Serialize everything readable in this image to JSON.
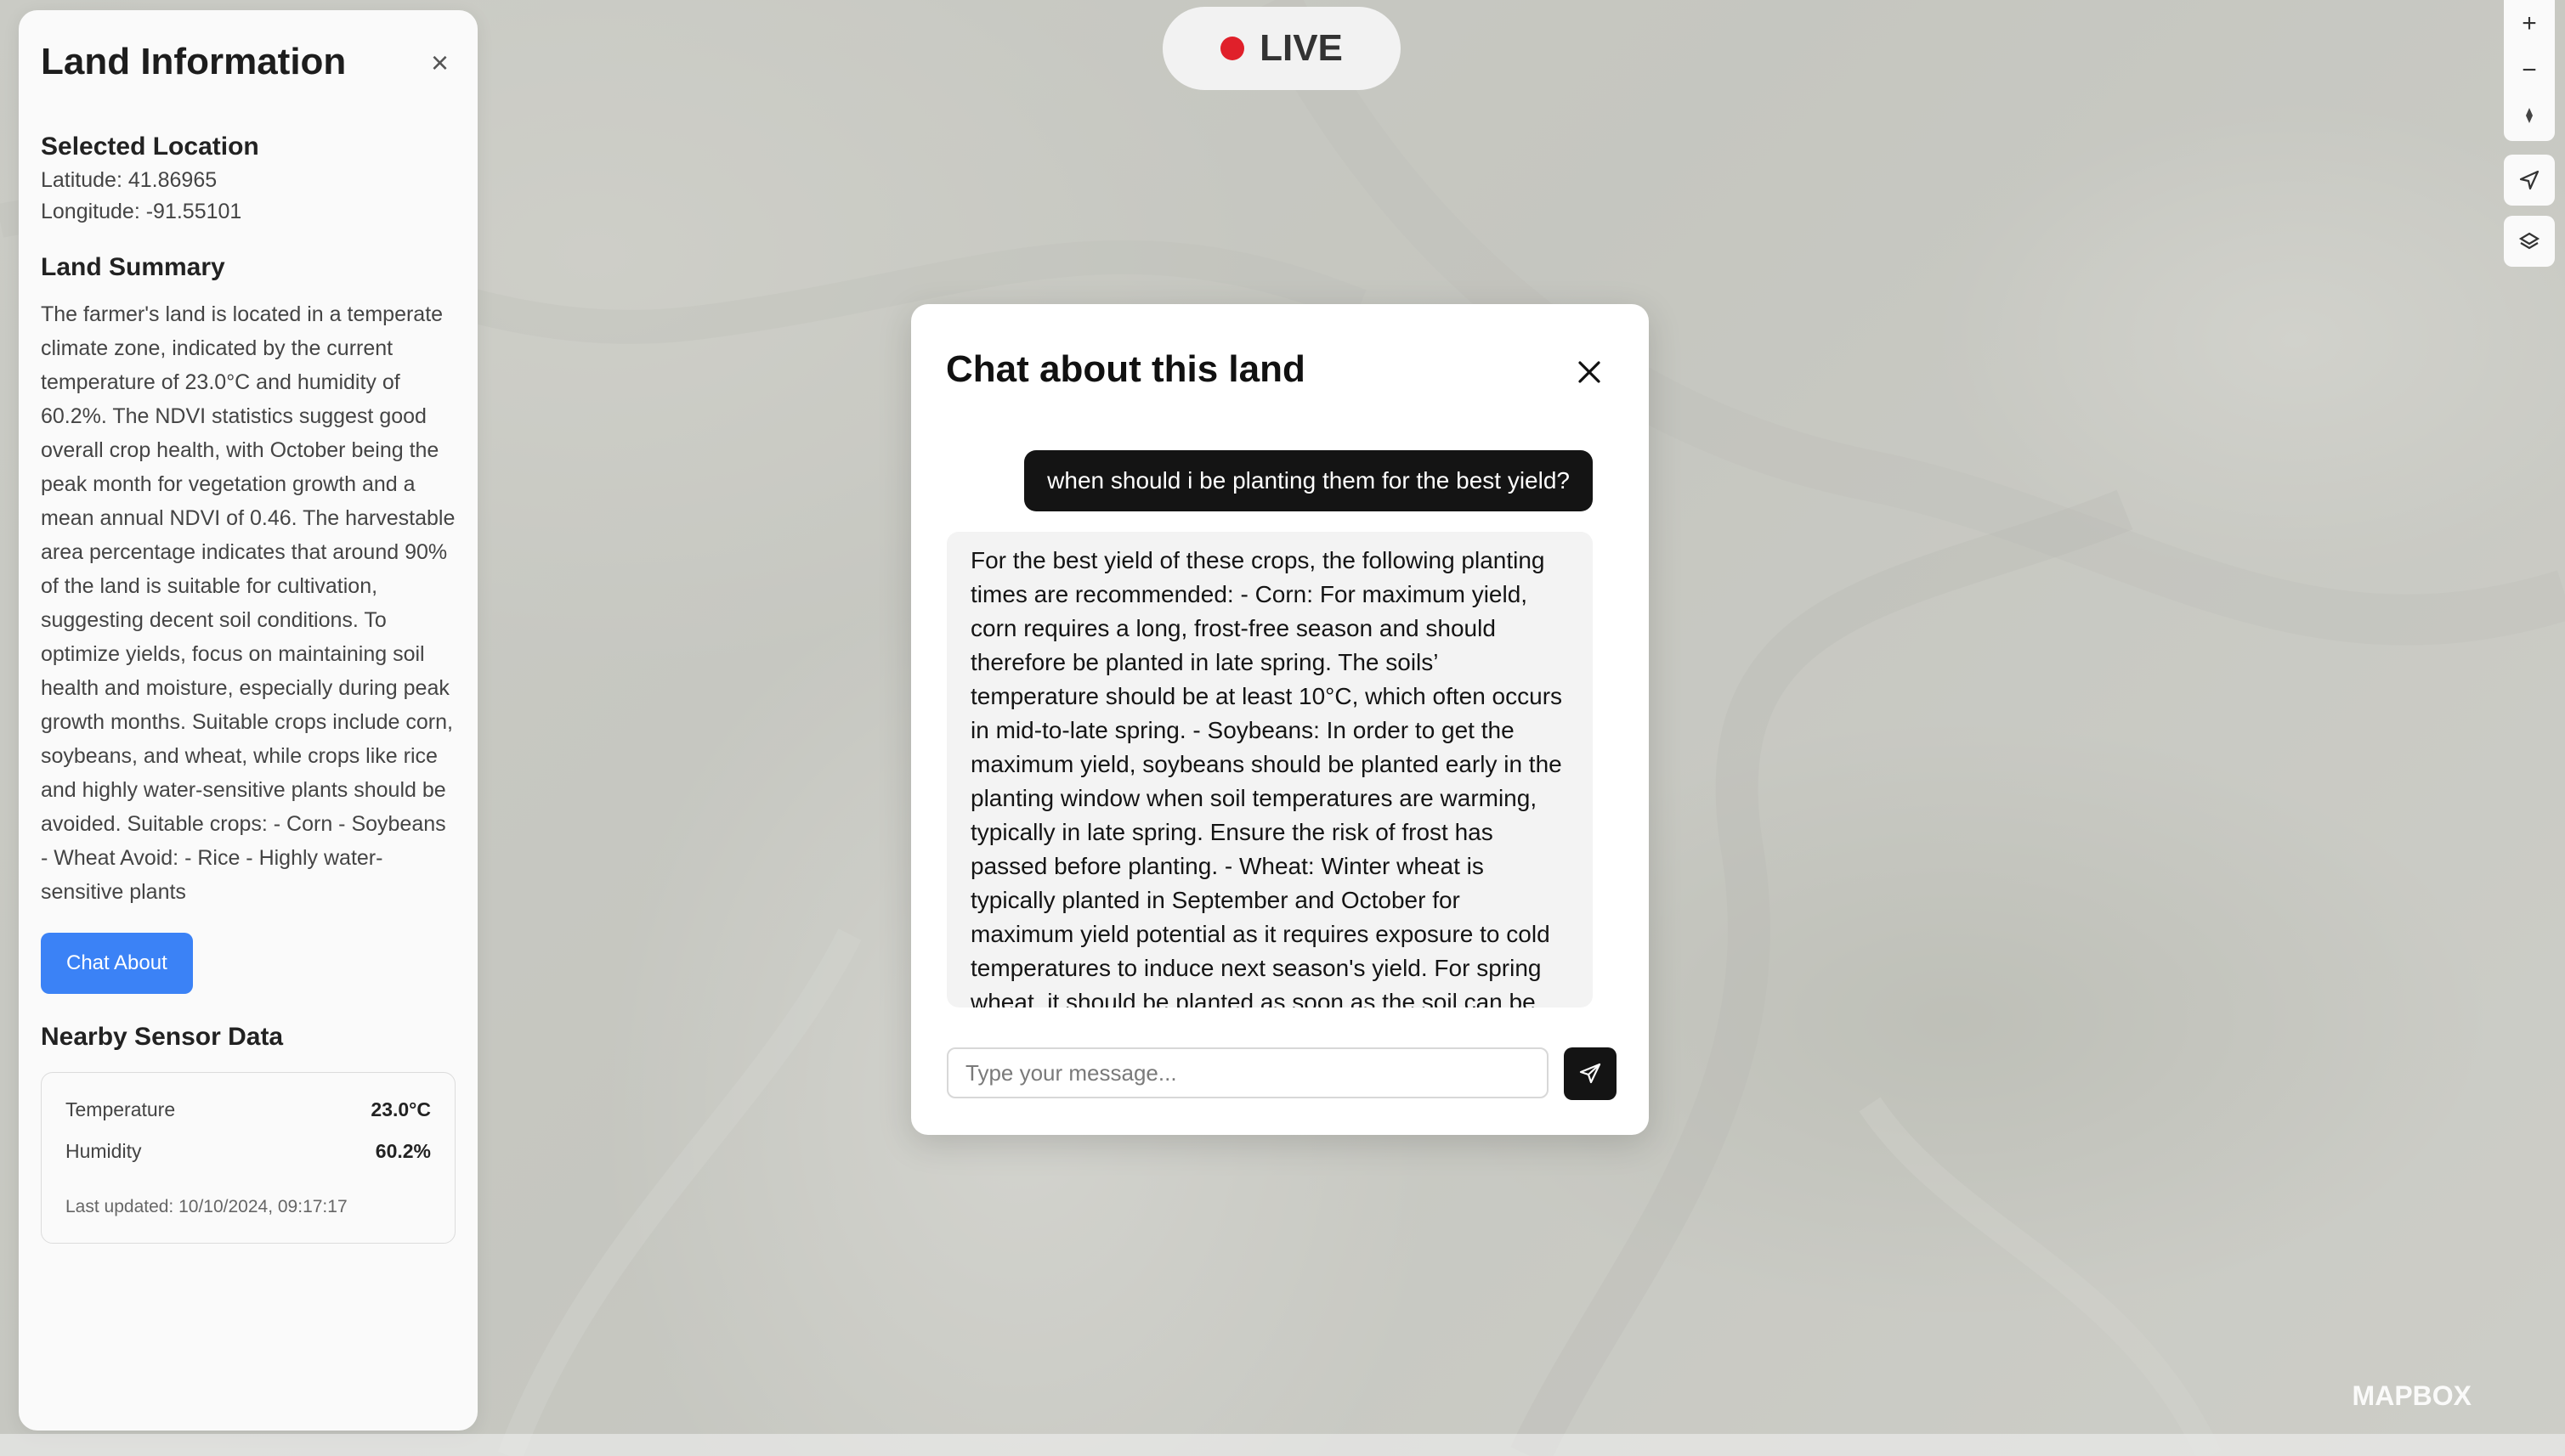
{
  "side_panel": {
    "title": "Land Information",
    "close_label": "×",
    "selected_location_heading": "Selected Location",
    "latitude": "Latitude: 41.86965",
    "longitude": "Longitude: -91.55101",
    "land_summary_heading": "Land Summary",
    "summary_text": "The farmer's land is located in a temperate climate zone, indicated by the current temperature of 23.0°C and humidity of 60.2%. The NDVI statistics suggest good overall crop health, with October being the peak month for vegetation growth and a mean annual NDVI of 0.46. The harvestable area percentage indicates that around 90% of the land is suitable for cultivation, suggesting decent soil conditions. To optimize yields, focus on maintaining soil health and moisture, especially during peak growth months. Suitable crops include corn, soybeans, and wheat, while crops like rice and highly water-sensitive plants should be avoided. Suitable crops: - Corn - Soybeans - Wheat Avoid: - Rice - Highly water-sensitive plants",
    "chat_button": "Chat About",
    "sensor_heading": "Nearby Sensor Data",
    "sensor_rows": [
      {
        "label": "Temperature",
        "value": "23.0°C"
      },
      {
        "label": "Humidity",
        "value": "60.2%"
      }
    ],
    "last_updated": "Last updated: 10/10/2024, 09:17:17"
  },
  "top_pill": {
    "label": "LIVE"
  },
  "map": {
    "zoom_in": "+",
    "zoom_out": "−",
    "attribution": "MAPBOX",
    "colors": {
      "overlay": "rgba(255,255,255,0.5)"
    }
  },
  "modal": {
    "title": "Chat about this land",
    "close_icon": "close-icon",
    "messages": {
      "user": "when should i be planting them for the best yield?",
      "assistant": "For the best yield of these crops, the following planting times are recommended: - Corn: For maximum yield, corn requires a long, frost-free season and should therefore be planted in late spring. The soils’ temperature should be at least 10°C, which often occurs in mid-to-late spring. - Soybeans: In order to get the maximum yield, soybeans should be planted early in the planting window when soil temperatures are warming, typically in late spring. Ensure the risk of frost has passed before planting. - Wheat: Winter wheat is typically planted in September and October for maximum yield potential as it requires exposure to cold temperatures to induce next season's yield. For spring wheat, it should be planted as soon as the soil can be worked"
    },
    "input": {
      "placeholder": "Type your message...",
      "value": ""
    },
    "send_icon": "send-icon"
  }
}
